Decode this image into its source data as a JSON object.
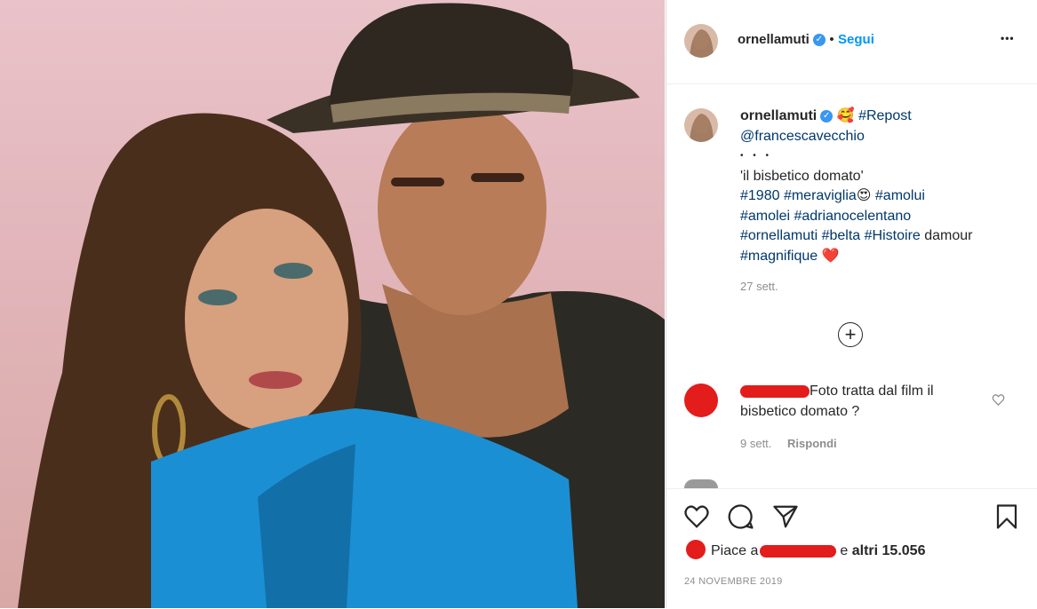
{
  "post": {
    "username": "ornellamuti",
    "follow_label": "Segui",
    "more_label": "•••",
    "image_alt": "Foto di Ornella Muti e Adriano Celentano"
  },
  "caption": {
    "username": "ornellamuti",
    "emoji_1": "🥰",
    "repost": "#Repost",
    "mention": "@francescavecchio",
    "dots": "• • •",
    "title": "'il bisbetico domato'",
    "tag_1980": "#1980",
    "tag_meraviglia": "#meraviglia",
    "emoji_2": "😍",
    "tag_amolui": "#amolui",
    "tag_amolei": "#amolei",
    "tag_adriano": "#adrianocelentano",
    "tag_ornella": "#ornellamuti",
    "tag_belta": "#belta",
    "tag_histoire": "#Histoire",
    "word_damour": "damour",
    "tag_magnifique": "#magnifique",
    "emoji_3": "❤️",
    "time": "27 sett."
  },
  "load_more_label": "+",
  "comment": {
    "text": "Foto tratta dal film il bisbetico domato ?",
    "time": "9 sett.",
    "reply_label": "Rispondi"
  },
  "likes": {
    "prefix": "Piace a",
    "suffix": "e",
    "count": "altri 15.056"
  },
  "date": "24 NOVEMBRE 2019",
  "colors": {
    "accent": "#0095f6",
    "verified": "#3897f0",
    "redaction": "#e31c1c"
  }
}
